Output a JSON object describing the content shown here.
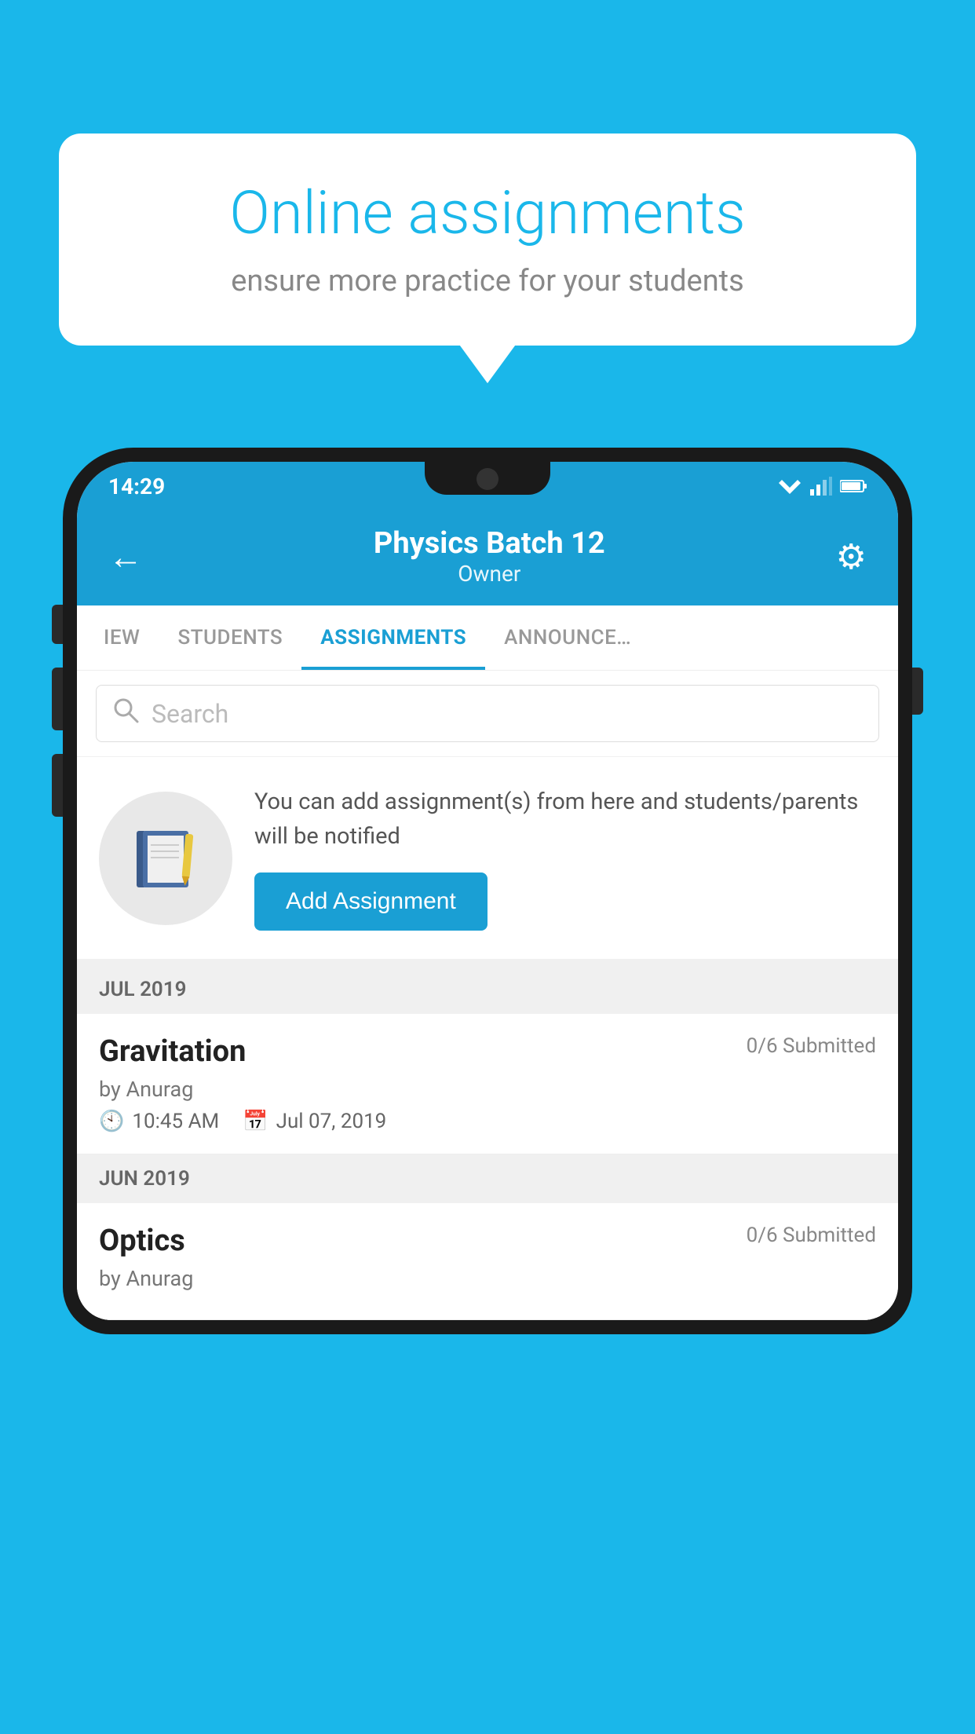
{
  "background_color": "#1ab7ea",
  "speech_bubble": {
    "title": "Online assignments",
    "subtitle": "ensure more practice for your students"
  },
  "status_bar": {
    "time": "14:29"
  },
  "app_header": {
    "title": "Physics Batch 12",
    "subtitle": "Owner",
    "back_label": "←",
    "gear_label": "⚙"
  },
  "tabs": [
    {
      "label": "IEW",
      "active": false
    },
    {
      "label": "STUDENTS",
      "active": false
    },
    {
      "label": "ASSIGNMENTS",
      "active": true
    },
    {
      "label": "ANNOUNCEMENTS",
      "active": false
    }
  ],
  "search": {
    "placeholder": "Search"
  },
  "promo": {
    "text": "You can add assignment(s) from here and students/parents will be notified",
    "button_label": "Add Assignment"
  },
  "sections": [
    {
      "month": "JUL 2019",
      "assignments": [
        {
          "name": "Gravitation",
          "submitted": "0/6 Submitted",
          "by": "by Anurag",
          "time": "10:45 AM",
          "date": "Jul 07, 2019"
        }
      ]
    },
    {
      "month": "JUN 2019",
      "assignments": [
        {
          "name": "Optics",
          "submitted": "0/6 Submitted",
          "by": "by Anurag",
          "time": "",
          "date": ""
        }
      ]
    }
  ]
}
